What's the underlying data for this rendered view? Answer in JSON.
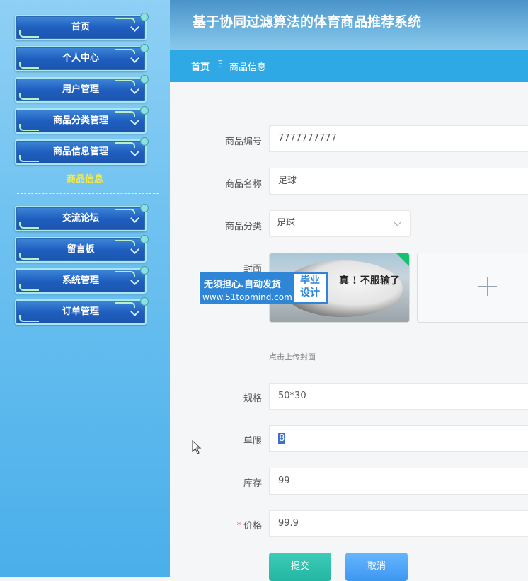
{
  "header": {
    "title": "基于协同过滤算法的体育商品推荐系统"
  },
  "breadcrumb": {
    "home": "首页",
    "separator": "Ξ",
    "current": "商品信息"
  },
  "sidebar": {
    "items": [
      {
        "label": "首页"
      },
      {
        "label": "个人中心"
      },
      {
        "label": "用户管理"
      },
      {
        "label": "商品分类管理"
      },
      {
        "label": "商品信息管理"
      },
      {
        "label": "交流论坛"
      },
      {
        "label": "留言板"
      },
      {
        "label": "系统管理"
      },
      {
        "label": "订单管理"
      }
    ],
    "submenu_active": "商品信息"
  },
  "form": {
    "code_label": "商品编号",
    "code_value": "7777777777",
    "name_label": "商品名称",
    "name_value": "足球",
    "category_label": "商品分类",
    "category_value": "足球",
    "cover_label": "封面",
    "cover_hint": "点击上传封面",
    "cover_image_text": "真 ! 不服输了",
    "spec_label": "规格",
    "spec_value": "50*30",
    "limit_label": "单限",
    "limit_value": "8",
    "stock_label": "库存",
    "stock_value": "99",
    "price_required": "*",
    "price_label": "价格",
    "price_value": "99.9",
    "submit_label": "提交",
    "cancel_label": "取消"
  },
  "watermark": {
    "main": "无须担心.自动发货",
    "url": "www.51topmind.com",
    "box_line1": "毕业",
    "box_line2": "设计"
  },
  "colors": {
    "sidebar_accent": "#1f5fc0",
    "breadcrumb_bar": "#2ea9e6",
    "submenu_active": "#f4e94a",
    "submit": "#25b6a3",
    "cancel": "#3e97f0"
  }
}
